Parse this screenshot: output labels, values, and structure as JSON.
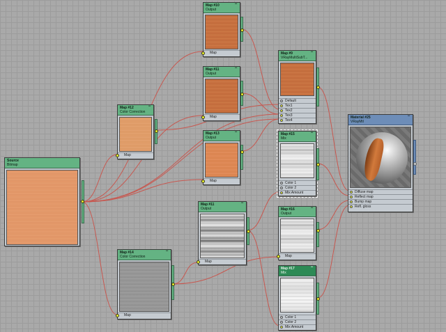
{
  "nodes": {
    "source": {
      "title": "Source",
      "subtitle": "Bitmap"
    },
    "map12": {
      "title": "Map #12",
      "subtitle": "Color Correction",
      "slot": "Map"
    },
    "map14": {
      "title": "Map #14",
      "subtitle": "Color Correction",
      "slot": "Map"
    },
    "map10": {
      "title": "Map #10",
      "subtitle": "Output",
      "slot": "Map"
    },
    "map11": {
      "title": "Map #11",
      "subtitle": "Output",
      "slot": "Map"
    },
    "map13": {
      "title": "Map #13",
      "subtitle": "Output",
      "slot": "Map"
    },
    "map9": {
      "title": "Map #9",
      "subtitle": "VRayMultiSubT...",
      "slots": [
        "Default",
        "Tex1",
        "Tex2",
        "Tex3",
        "Tex4"
      ]
    },
    "map15": {
      "title": "Map #15",
      "subtitle": "Mix",
      "slots": [
        "Color 1",
        "Color 2",
        "Mix Amount"
      ]
    },
    "map16": {
      "title": "Map #16",
      "subtitle": "Output",
      "slot": "Map"
    },
    "map17": {
      "title": "Map #17",
      "subtitle": "Mix",
      "slots": [
        "Color 1",
        "Color 2",
        "Mix Amount"
      ]
    },
    "map18": {
      "title": "Map #18",
      "subtitle": "Output",
      "slot": "Map"
    },
    "material": {
      "title": "Material #25",
      "subtitle": "VRayMtl",
      "slots": [
        "Diffuse map",
        "Reflect map",
        "Bump map",
        "Refl. gloss"
      ]
    }
  },
  "colors": {
    "header": "#64b383",
    "header_dark": "#2d8a55",
    "wire": "#c8574f",
    "socket": "#e9f02a",
    "node_body": "#c5cbd1"
  }
}
